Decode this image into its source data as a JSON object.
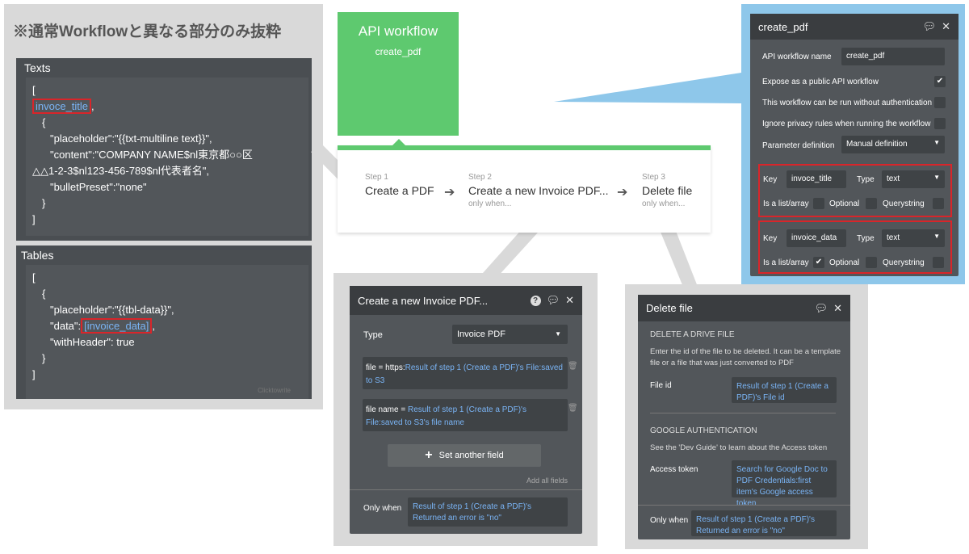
{
  "note": "※通常Workflowと異なる部分のみ抜粋",
  "texts": {
    "title": "Texts",
    "lines": [
      "[",
      "invoce_title",
      ",",
      "{",
      "\"placeholder\":\"{{txt-multiline text}}\",",
      "\"content\":\"COMPANY NAME$nl東京都○○区",
      "△△1-2-3$nl123-456-789$nl代表者名\",",
      "\"bulletPreset\":\"none\"",
      "}",
      "]"
    ]
  },
  "tables": {
    "title": "Tables",
    "lines": [
      "[",
      "{",
      "\"placeholder\":\"{{tbl-data}}\",",
      "\"data\":",
      "[invoice_data]",
      ",",
      "\"withHeader\": true",
      "}",
      "]"
    ],
    "faded": "Clicktowrite"
  },
  "api_box": {
    "title": "API workflow",
    "subtitle": "create_pdf"
  },
  "steps": [
    {
      "num": "Step 1",
      "name": "Create a PDF",
      "cond": ""
    },
    {
      "num": "Step 2",
      "name": "Create a new Invoice PDF...",
      "cond": "only when..."
    },
    {
      "num": "Step 3",
      "name": "Delete file",
      "cond": "only when..."
    }
  ],
  "create_pdf_panel": {
    "title": "create_pdf",
    "name_label": "API workflow name",
    "name_value": "create_pdf",
    "expose": "Expose as a public API workflow",
    "no_auth": "This workflow can be run without authentication",
    "ignore_privacy": "Ignore privacy rules when running the workflow",
    "param_label": "Parameter definition",
    "param_value": "Manual definition",
    "params": [
      {
        "key_label": "Key",
        "key": "invoce_title",
        "type_label": "Type",
        "type": "text",
        "list_label": "Is a list/array",
        "optional": "Optional",
        "querystring": "Querystring",
        "list_checked": false
      },
      {
        "key_label": "Key",
        "key": "invoice_data",
        "type_label": "Type",
        "type": "text",
        "list_label": "Is a list/array",
        "optional": "Optional",
        "querystring": "Querystring",
        "list_checked": true
      }
    ]
  },
  "invoice_panel": {
    "title": "Create a new Invoice PDF...",
    "type_label": "Type",
    "type_value": "Invoice PDF",
    "field1_prefix": "file  =  https:",
    "field1_link": "Result of step 1 (Create a PDF)'s File:saved to S3",
    "field2_prefix": "file name  =  ",
    "field2_link": "Result of step 1 (Create a PDF)'s File:saved to S3's file name",
    "set_field": "Set another field",
    "add_all": "Add all fields",
    "only_when": "Only when",
    "only_when_value": "Result of step 1 (Create a PDF)'s Returned an error is \"no\""
  },
  "delete_panel": {
    "title": "Delete file",
    "section1": "DELETE A DRIVE FILE",
    "desc1": "Enter the id of the file to be deleted. It can be a template file or a file that was just converted to PDF",
    "file_id_label": "File id",
    "file_id_value": "Result of step 1 (Create a PDF)'s File id",
    "section2": "GOOGLE AUTHENTICATION",
    "desc2": "See the 'Dev Guide' to learn about the Access token",
    "token_label": "Access token",
    "token_value": "Search for Google Doc to PDF Credentials:first item's Google access token",
    "only_when": "Only when",
    "only_when_value": "Result of step 1 (Create a PDF)'s Returned an error is \"no\""
  },
  "colors": {
    "green": "#5ec96f",
    "blue_bg": "#8ec7ea",
    "red": "#d9252a",
    "link": "#7ab4f5"
  }
}
